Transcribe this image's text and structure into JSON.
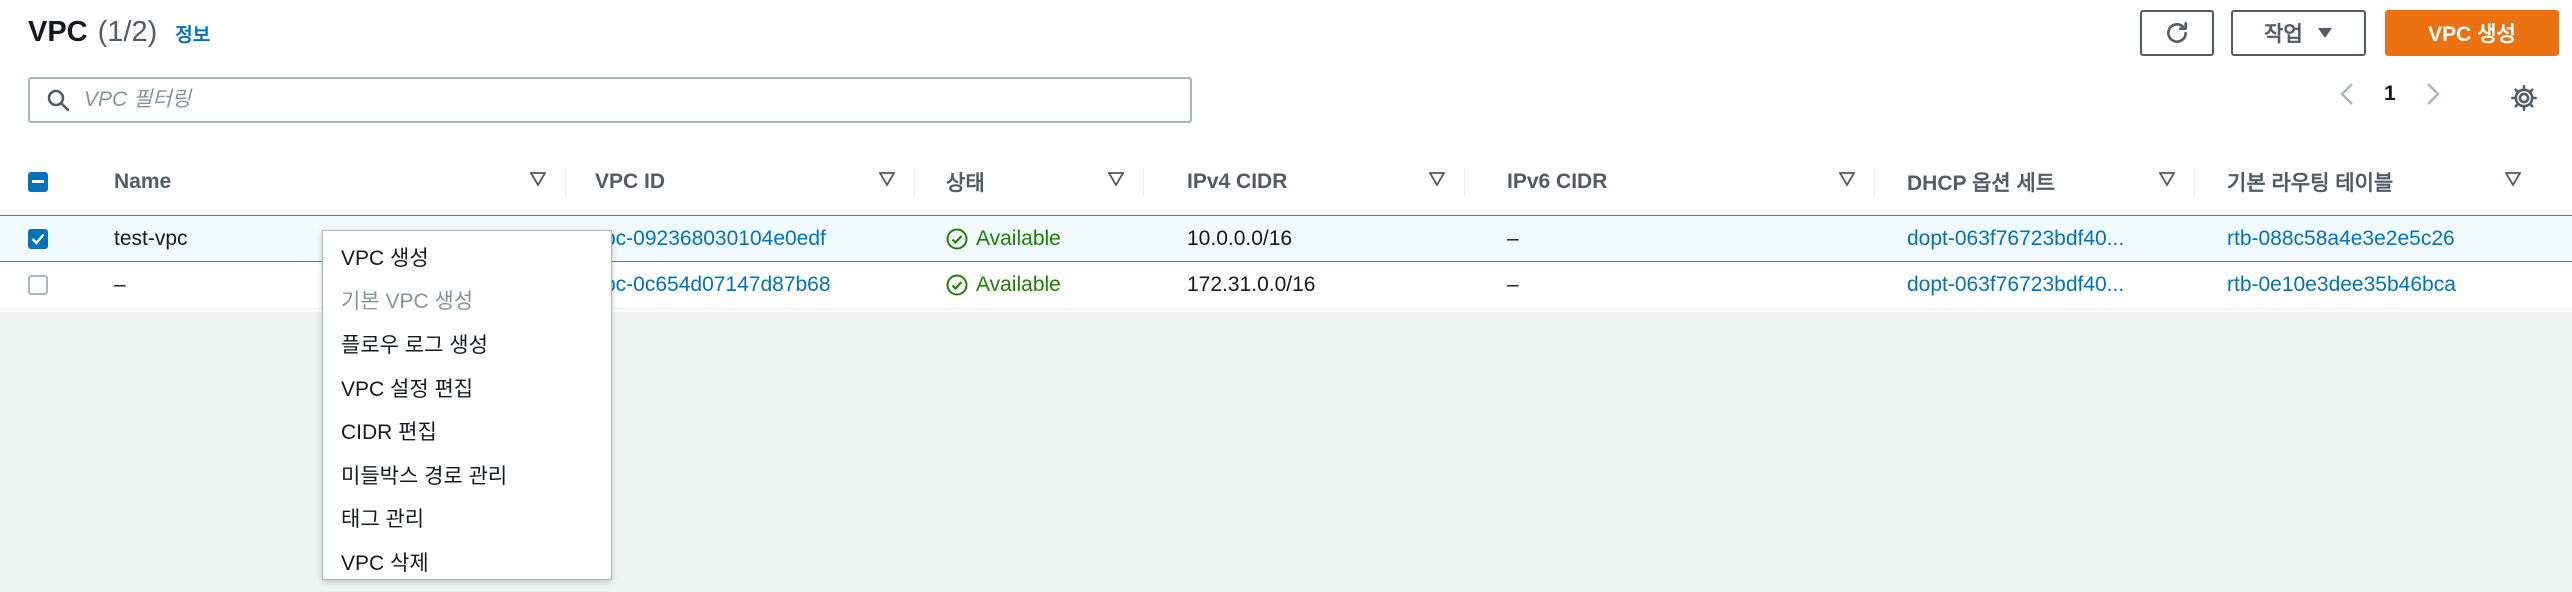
{
  "header": {
    "title": "VPC",
    "count": "(1/2)",
    "info": "정보",
    "actions_label": "작업",
    "create_label": "VPC 생성"
  },
  "search": {
    "placeholder": "VPC 필터링",
    "value": ""
  },
  "pagination": {
    "page": "1"
  },
  "table": {
    "columns": [
      "Name",
      "VPC ID",
      "상태",
      "IPv4 CIDR",
      "IPv6 CIDR",
      "DHCP 옵션 세트",
      "기본 라우팅 테이블"
    ],
    "rows": [
      {
        "selected": true,
        "name": "test-vpc",
        "vpc_id": "pc-092368030104e0edf",
        "status": "Available",
        "ipv4": "10.0.0.0/16",
        "ipv6": "–",
        "dhcp": "dopt-063f76723bdf40...",
        "route_table": "rtb-088c58a4e3e2e5c26"
      },
      {
        "selected": false,
        "name": "–",
        "vpc_id": "pc-0c654d07147d87b68",
        "status": "Available",
        "ipv4": "172.31.0.0/16",
        "ipv6": "–",
        "dhcp": "dopt-063f76723bdf40...",
        "route_table": "rtb-0e10e3dee35b46bca"
      }
    ]
  },
  "context_menu": {
    "items": [
      {
        "label": "VPC 생성",
        "disabled": false
      },
      {
        "label": "기본 VPC 생성",
        "disabled": true
      },
      {
        "label": "플로우 로그 생성",
        "disabled": false
      },
      {
        "label": "VPC 설정 편집",
        "disabled": false
      },
      {
        "label": "CIDR 편집",
        "disabled": false
      },
      {
        "label": "미들박스 경로 관리",
        "disabled": false
      },
      {
        "label": "태그 관리",
        "disabled": false
      },
      {
        "label": "VPC 삭제",
        "disabled": false
      }
    ]
  },
  "colors": {
    "accent": "#ec7211",
    "link": "#0073bb",
    "available": "#1d8102",
    "selected_row": "#f1faff"
  },
  "icons": [
    "refresh-icon",
    "caret-down-icon",
    "search-icon",
    "chevron-left-icon",
    "chevron-right-icon",
    "gear-icon",
    "sort-icon",
    "status-check-icon",
    "checkbox-icon"
  ]
}
